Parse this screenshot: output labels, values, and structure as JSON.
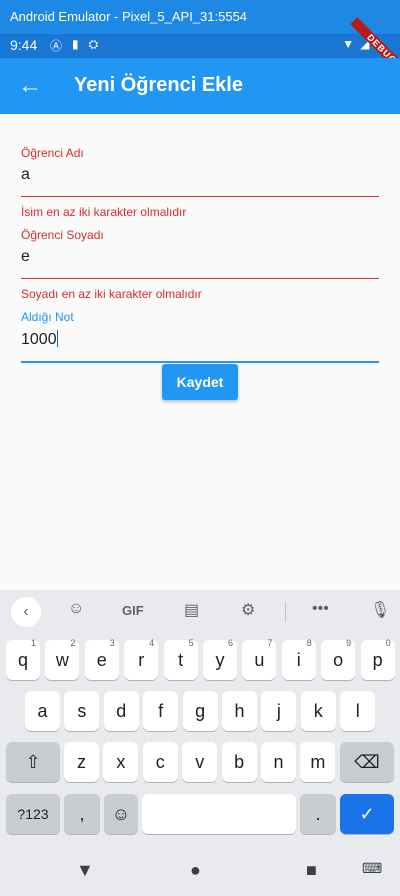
{
  "window_title": "Android Emulator - Pixel_5_API_31:5554",
  "status": {
    "time": "9:44"
  },
  "debug_banner": "DEBUG",
  "appbar": {
    "title": "Yeni Öğrenci Ekle"
  },
  "form": {
    "name": {
      "label": "Öğrenci Adı",
      "value": "a",
      "error": "İsim en az iki karakter olmalıdır"
    },
    "surname": {
      "label": "Öğrenci Soyadı",
      "value": "e",
      "error": "Soyadı en az iki karakter olmalıdır"
    },
    "grade": {
      "label": "Aldığı Not",
      "value": "1000"
    },
    "save_label": "Kaydet"
  },
  "colors": {
    "error": "#d32f2f",
    "accent": "#2196f3"
  },
  "keyboard": {
    "gif_label": "GIF",
    "row1": [
      {
        "k": "q",
        "h": "1"
      },
      {
        "k": "w",
        "h": "2"
      },
      {
        "k": "e",
        "h": "3"
      },
      {
        "k": "r",
        "h": "4"
      },
      {
        "k": "t",
        "h": "5"
      },
      {
        "k": "y",
        "h": "6"
      },
      {
        "k": "u",
        "h": "7"
      },
      {
        "k": "i",
        "h": "8"
      },
      {
        "k": "o",
        "h": "9"
      },
      {
        "k": "p",
        "h": "0"
      }
    ],
    "row2": [
      "a",
      "s",
      "d",
      "f",
      "g",
      "h",
      "j",
      "k",
      "l"
    ],
    "row3": [
      "z",
      "x",
      "c",
      "v",
      "b",
      "n",
      "m"
    ],
    "num_label": "?123",
    "comma": ",",
    "period": "."
  }
}
